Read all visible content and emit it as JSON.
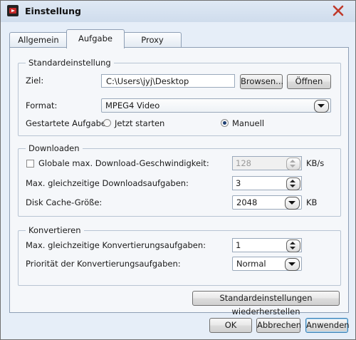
{
  "window": {
    "title": "Einstellung"
  },
  "tabs": [
    {
      "label": "Allgemein"
    },
    {
      "label": "Aufgabe"
    },
    {
      "label": "Proxy"
    }
  ],
  "standard": {
    "title": "Standardeinstellung",
    "target_label": "Ziel:",
    "target_value": "C:\\Users\\jyj\\Desktop",
    "browse_label": "Browsen...",
    "open_label": "Öffnen",
    "format_label": "Format:",
    "format_value": "MPEG4 Video",
    "started_label": "Gestartete Aufgabe:",
    "start_now_label": "Jetzt starten",
    "manual_label": "Manuell"
  },
  "downloads": {
    "title": "Downloaden",
    "global_speed_label": "Globale max. Download-Geschwindigkeit:",
    "global_speed_value": "128",
    "speed_unit": "KB/s",
    "max_downloads_label": "Max. gleichzeitige Downloadsaufgaben:",
    "max_downloads_value": "3",
    "cache_label": "Disk Cache-Größe:",
    "cache_value": "2048",
    "cache_unit": "KB"
  },
  "convert": {
    "title": "Konvertieren",
    "max_convert_label": "Max. gleichzeitige Konvertierungsaufgaben:",
    "max_convert_value": "1",
    "priority_label": "Priorität der Konvertierungsaufgaben:",
    "priority_value": "Normal"
  },
  "restore_label": "Standardeinstellungen wiederherstellen",
  "footer": {
    "ok": "OK",
    "cancel": "Abbrechen",
    "apply": "Anwenden"
  }
}
